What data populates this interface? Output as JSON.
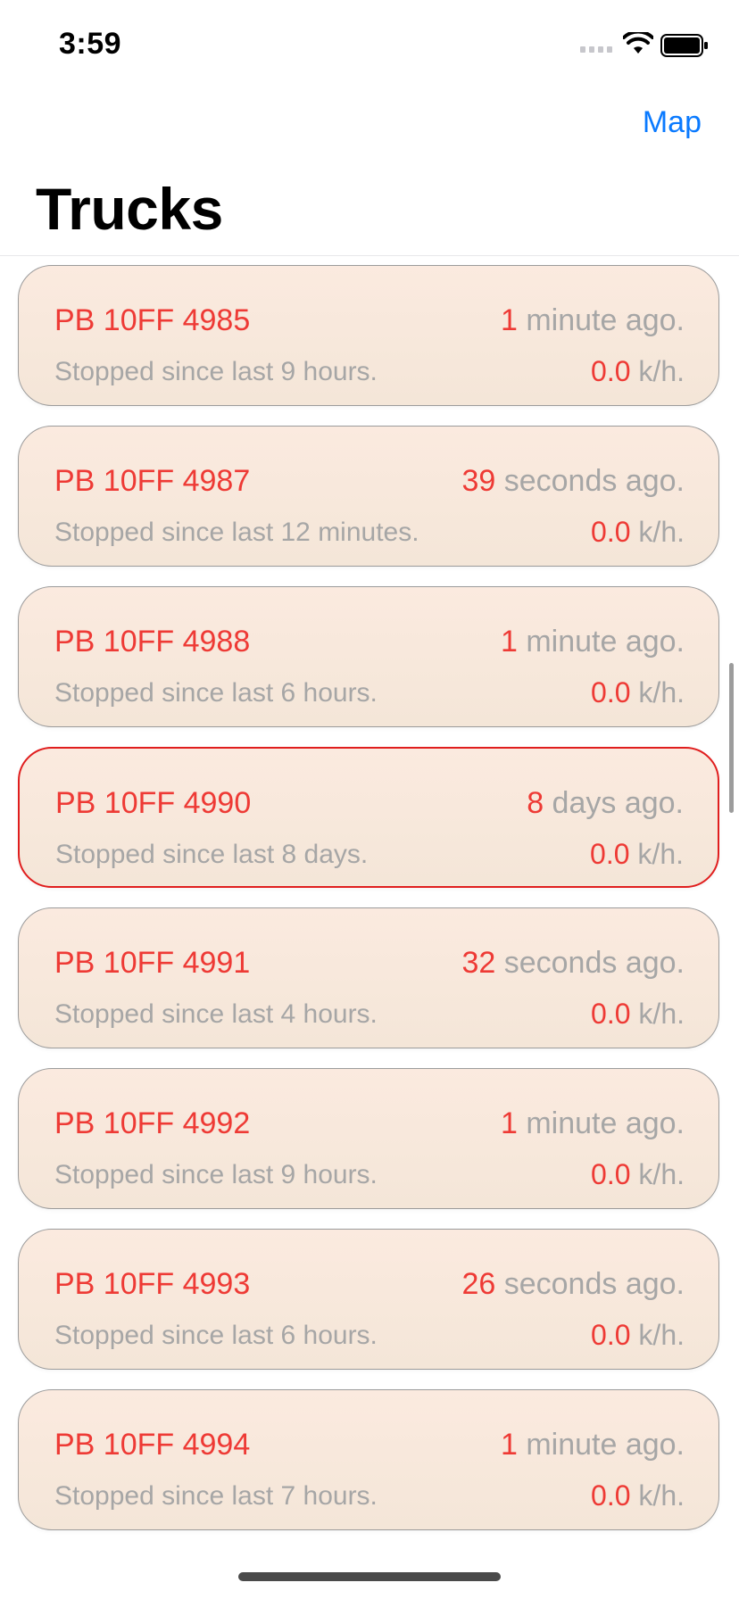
{
  "status_bar": {
    "time": "3:59",
    "signal_icon": "cellular-signal-icon",
    "wifi_icon": "wifi-icon",
    "battery_icon": "battery-icon"
  },
  "nav": {
    "map_label": "Map",
    "title": "Trucks"
  },
  "colors": {
    "accent": "#0a7aff",
    "highlight_red": "#ee3a35",
    "alert_border": "#e01e1e",
    "card_bg": "#f4e6d8",
    "muted_text": "#a6a6a6"
  },
  "trucks": [
    {
      "plate": "PB 10FF 4985",
      "ago_num": "1",
      "ago_unit": " minute ago.",
      "stopped": "Stopped since last 9 hours.",
      "speed": "0.0",
      "speed_unit": " k/h.",
      "alert": false
    },
    {
      "plate": "PB 10FF 4987",
      "ago_num": "39",
      "ago_unit": " seconds ago.",
      "stopped": "Stopped since last 12 minutes.",
      "speed": "0.0",
      "speed_unit": " k/h.",
      "alert": false
    },
    {
      "plate": "PB 10FF 4988",
      "ago_num": "1",
      "ago_unit": " minute ago.",
      "stopped": "Stopped since last 6 hours.",
      "speed": "0.0",
      "speed_unit": " k/h.",
      "alert": false
    },
    {
      "plate": "PB 10FF 4990",
      "ago_num": "8",
      "ago_unit": " days ago.",
      "stopped": "Stopped since last 8 days.",
      "speed": "0.0",
      "speed_unit": " k/h.",
      "alert": true
    },
    {
      "plate": "PB 10FF 4991",
      "ago_num": "32",
      "ago_unit": " seconds ago.",
      "stopped": "Stopped since last 4 hours.",
      "speed": "0.0",
      "speed_unit": " k/h.",
      "alert": false
    },
    {
      "plate": "PB 10FF 4992",
      "ago_num": "1",
      "ago_unit": " minute ago.",
      "stopped": "Stopped since last 9 hours.",
      "speed": "0.0",
      "speed_unit": " k/h.",
      "alert": false
    },
    {
      "plate": "PB 10FF 4993",
      "ago_num": "26",
      "ago_unit": " seconds ago.",
      "stopped": "Stopped since last 6 hours.",
      "speed": "0.0",
      "speed_unit": " k/h.",
      "alert": false
    },
    {
      "plate": "PB 10FF 4994",
      "ago_num": "1",
      "ago_unit": " minute ago.",
      "stopped": "Stopped since last 7 hours.",
      "speed": "0.0",
      "speed_unit": " k/h.",
      "alert": false
    }
  ]
}
